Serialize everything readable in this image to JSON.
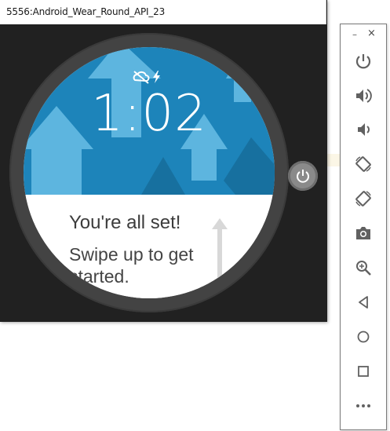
{
  "window": {
    "title": "5556:Android_Wear_Round_API_23"
  },
  "watch": {
    "time": "1:02",
    "status_icons": [
      "cloud-off-icon",
      "bolt-icon"
    ],
    "card": {
      "title": "You're all set!",
      "body": "Swipe up to get started."
    },
    "colors": {
      "face_blue": "#1d84ba",
      "arrow_light": "#5db5df",
      "arrow_dark": "#17709f",
      "bezel": "#434343"
    }
  },
  "toolbar": {
    "controls": {
      "minimize_label": "–",
      "close_label": "×"
    },
    "buttons": [
      {
        "name": "power-icon"
      },
      {
        "name": "volume-up-icon"
      },
      {
        "name": "volume-down-icon"
      },
      {
        "name": "rotate-left-icon"
      },
      {
        "name": "rotate-right-icon"
      },
      {
        "name": "camera-icon"
      },
      {
        "name": "zoom-icon"
      },
      {
        "name": "back-icon"
      },
      {
        "name": "home-icon"
      },
      {
        "name": "overview-icon"
      },
      {
        "name": "more-icon"
      }
    ]
  }
}
